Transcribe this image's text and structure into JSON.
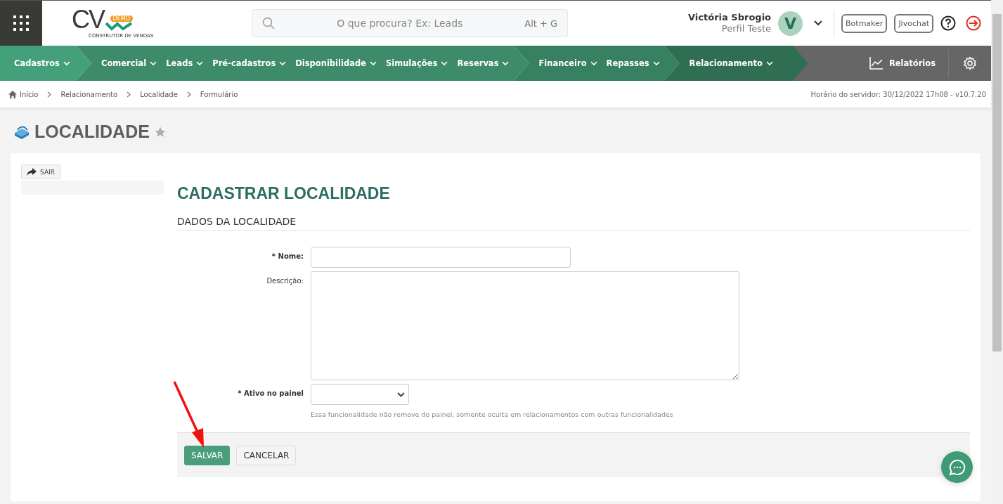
{
  "header": {
    "logo": {
      "mark": "CV",
      "badge": "DEMO",
      "tagline": "CONSTRUTOR DE VENDAS"
    },
    "search": {
      "placeholder": "O que procura? Ex: Leads",
      "shortcut": "Alt + G"
    },
    "user": {
      "name": "Victória Sbrogio",
      "profile": "Perfil Teste",
      "initial": "V"
    },
    "buttons": [
      "Botmaker",
      "Jivochat"
    ]
  },
  "nav": {
    "groups": [
      {
        "items": [
          "Cadastros"
        ]
      },
      {
        "items": [
          "Comercial",
          "Leads",
          "Pré-cadastros",
          "Disponibilidade",
          "Simulações",
          "Reservas"
        ]
      },
      {
        "items": [
          "Financeiro",
          "Repasses"
        ]
      },
      {
        "items": [
          "Relacionamento"
        ]
      }
    ],
    "reports": "Relatórios"
  },
  "breadcrumb": {
    "items": [
      "Início",
      "Relacionamento",
      "Localidade",
      "Formulário"
    ],
    "server": "Horário do servidor: 30/12/2022 17h08 - v10.7.20"
  },
  "page": {
    "title": "LOCALIDADE",
    "favorite": false
  },
  "sidebar": {
    "exit": "SAIR"
  },
  "form": {
    "title": "CADASTRAR LOCALIDADE",
    "section": "DADOS DA LOCALIDADE",
    "fields": [
      {
        "kind": "text",
        "label": "* Nome:",
        "required": true
      },
      {
        "kind": "textarea",
        "label": "Descrição:",
        "required": false
      },
      {
        "kind": "select",
        "label": "* Ativo no painel",
        "required": true,
        "help": "Essa funcionalidade não remove do painel, somente oculta em relacionamentos com outras funcionalidades"
      }
    ],
    "buttons": [
      {
        "label": "SALVAR",
        "kind": "primary"
      },
      {
        "label": "CANCELAR",
        "kind": "secondary"
      }
    ]
  }
}
